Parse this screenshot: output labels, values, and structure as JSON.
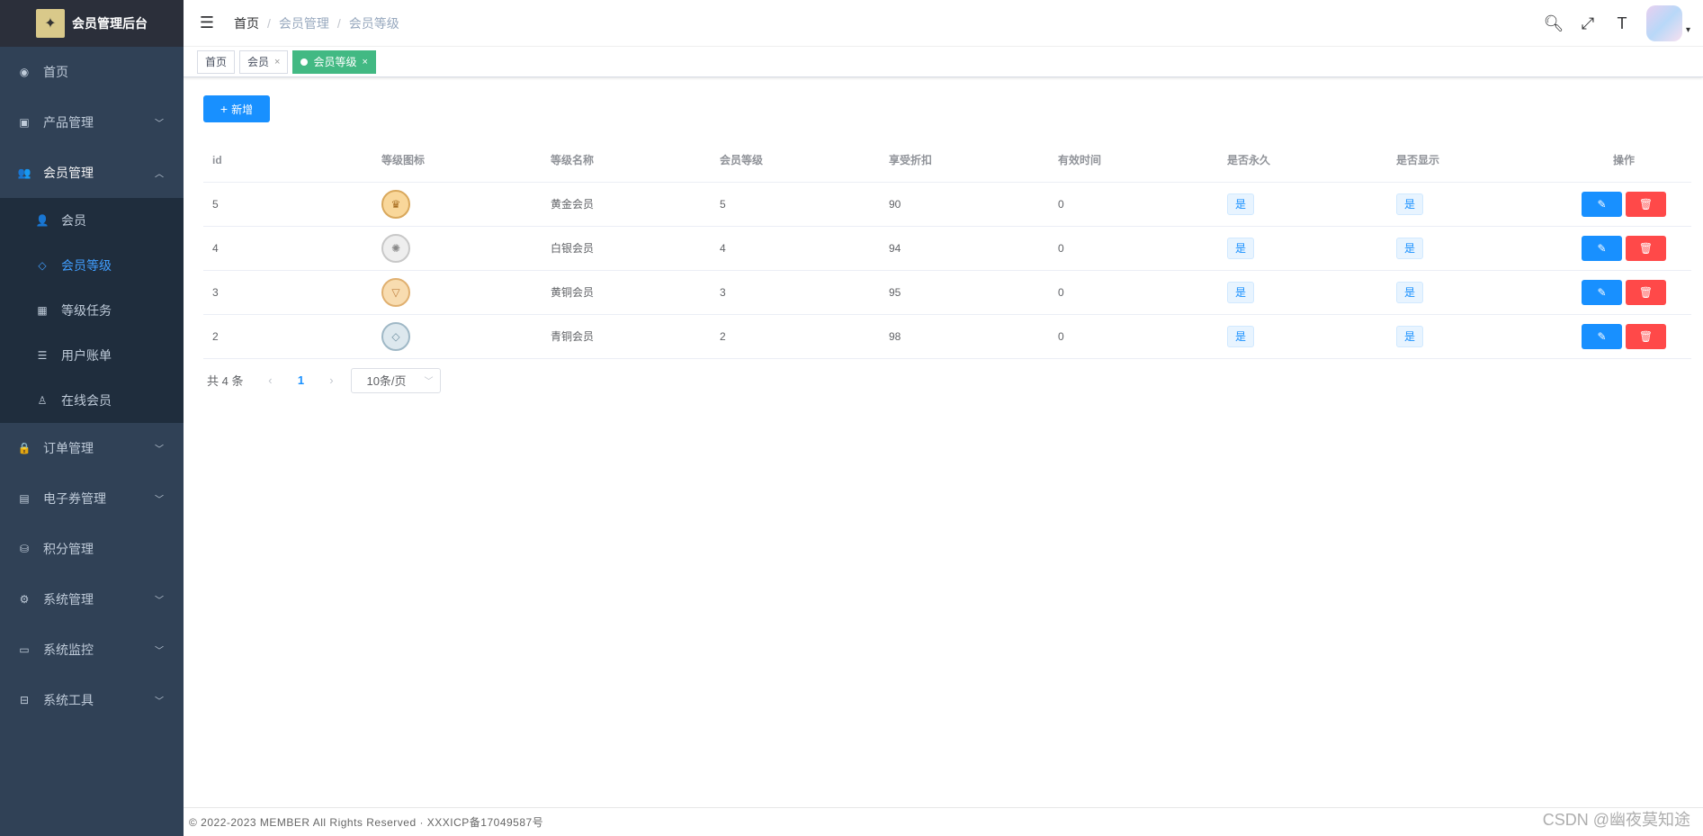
{
  "sidebar": {
    "logo_title": "会员管理后台",
    "items": [
      {
        "label": "首页",
        "icon": "dashboard-icon"
      },
      {
        "label": "产品管理",
        "icon": "product-icon"
      },
      {
        "label": "会员管理",
        "icon": "member-icon"
      },
      {
        "label": "订单管理",
        "icon": "lock-icon"
      },
      {
        "label": "电子券管理",
        "icon": "coupon-icon"
      },
      {
        "label": "积分管理",
        "icon": "points-icon"
      },
      {
        "label": "系统管理",
        "icon": "gear-icon"
      },
      {
        "label": "系统监控",
        "icon": "monitor-icon"
      },
      {
        "label": "系统工具",
        "icon": "toolbox-icon"
      }
    ],
    "submenu": [
      {
        "label": "会员",
        "icon": "user-icon"
      },
      {
        "label": "会员等级",
        "icon": "diamond-icon"
      },
      {
        "label": "等级任务",
        "icon": "task-icon"
      },
      {
        "label": "用户账单",
        "icon": "list-icon"
      },
      {
        "label": "在线会员",
        "icon": "online-icon"
      }
    ]
  },
  "navbar": {
    "breadcrumb": [
      "首页",
      "会员管理",
      "会员等级"
    ]
  },
  "tags": [
    "首页",
    "会员",
    "会员等级"
  ],
  "toolbar": {
    "add_label": "新增"
  },
  "table": {
    "headers": [
      "id",
      "等级图标",
      "等级名称",
      "会员等级",
      "享受折扣",
      "有效时间",
      "是否永久",
      "是否显示",
      "操作"
    ],
    "rows": [
      {
        "id": "5",
        "name": "黄金会员",
        "level": "5",
        "discount": "90",
        "valid": "0",
        "permanent": "是",
        "show": "是"
      },
      {
        "id": "4",
        "name": "白银会员",
        "level": "4",
        "discount": "94",
        "valid": "0",
        "permanent": "是",
        "show": "是"
      },
      {
        "id": "3",
        "name": "黄铜会员",
        "level": "3",
        "discount": "95",
        "valid": "0",
        "permanent": "是",
        "show": "是"
      },
      {
        "id": "2",
        "name": "青铜会员",
        "level": "2",
        "discount": "98",
        "valid": "0",
        "permanent": "是",
        "show": "是"
      }
    ]
  },
  "pagination": {
    "total": "共 4 条",
    "current": "1",
    "page_size": "10条/页"
  },
  "footer": {
    "text": "© 2022-2023 MEMBER All Rights Reserved · XXXICP备17049587号"
  },
  "watermark": "CSDN @幽夜莫知途",
  "colors": {
    "sidebar_bg": "#304156",
    "submenu_bg": "#1f2d3d",
    "primary": "#1890ff",
    "danger": "#ff4949",
    "tag_active": "#42b983"
  }
}
